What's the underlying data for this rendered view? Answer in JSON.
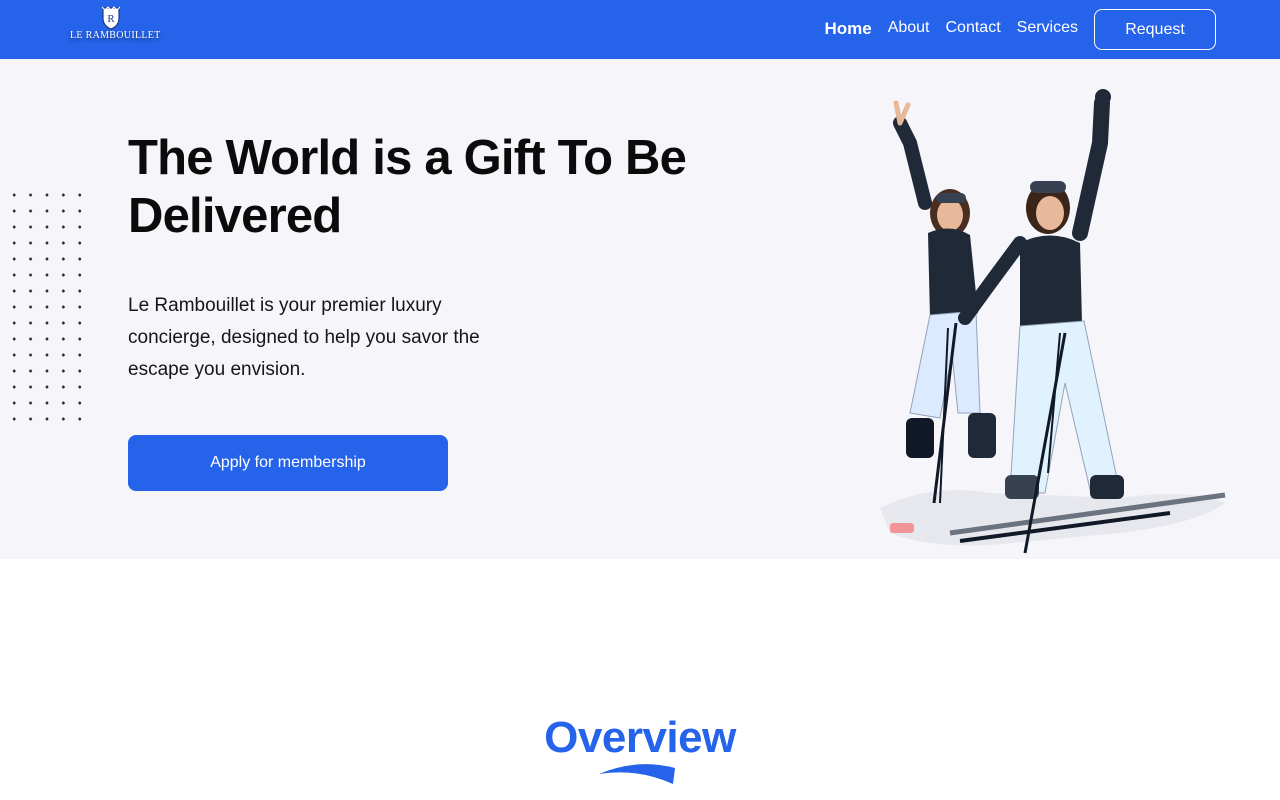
{
  "brand": {
    "name": "LE RAMBOUILLET",
    "crest_letter": "R",
    "primary_color": "#2563eb"
  },
  "nav": {
    "links": [
      "Home",
      "About",
      "Contact",
      "Services"
    ],
    "active": "Home",
    "request_label": "Request"
  },
  "hero": {
    "title": "The World is a Gift To Be Delivered",
    "description": "Le Rambouillet is your premier luxury concierge, designed to help you savor the escape you envision.",
    "cta_label": "Apply for membership",
    "image": "two-skiers-celebrating-photo"
  },
  "overview": {
    "title": "Overview"
  }
}
